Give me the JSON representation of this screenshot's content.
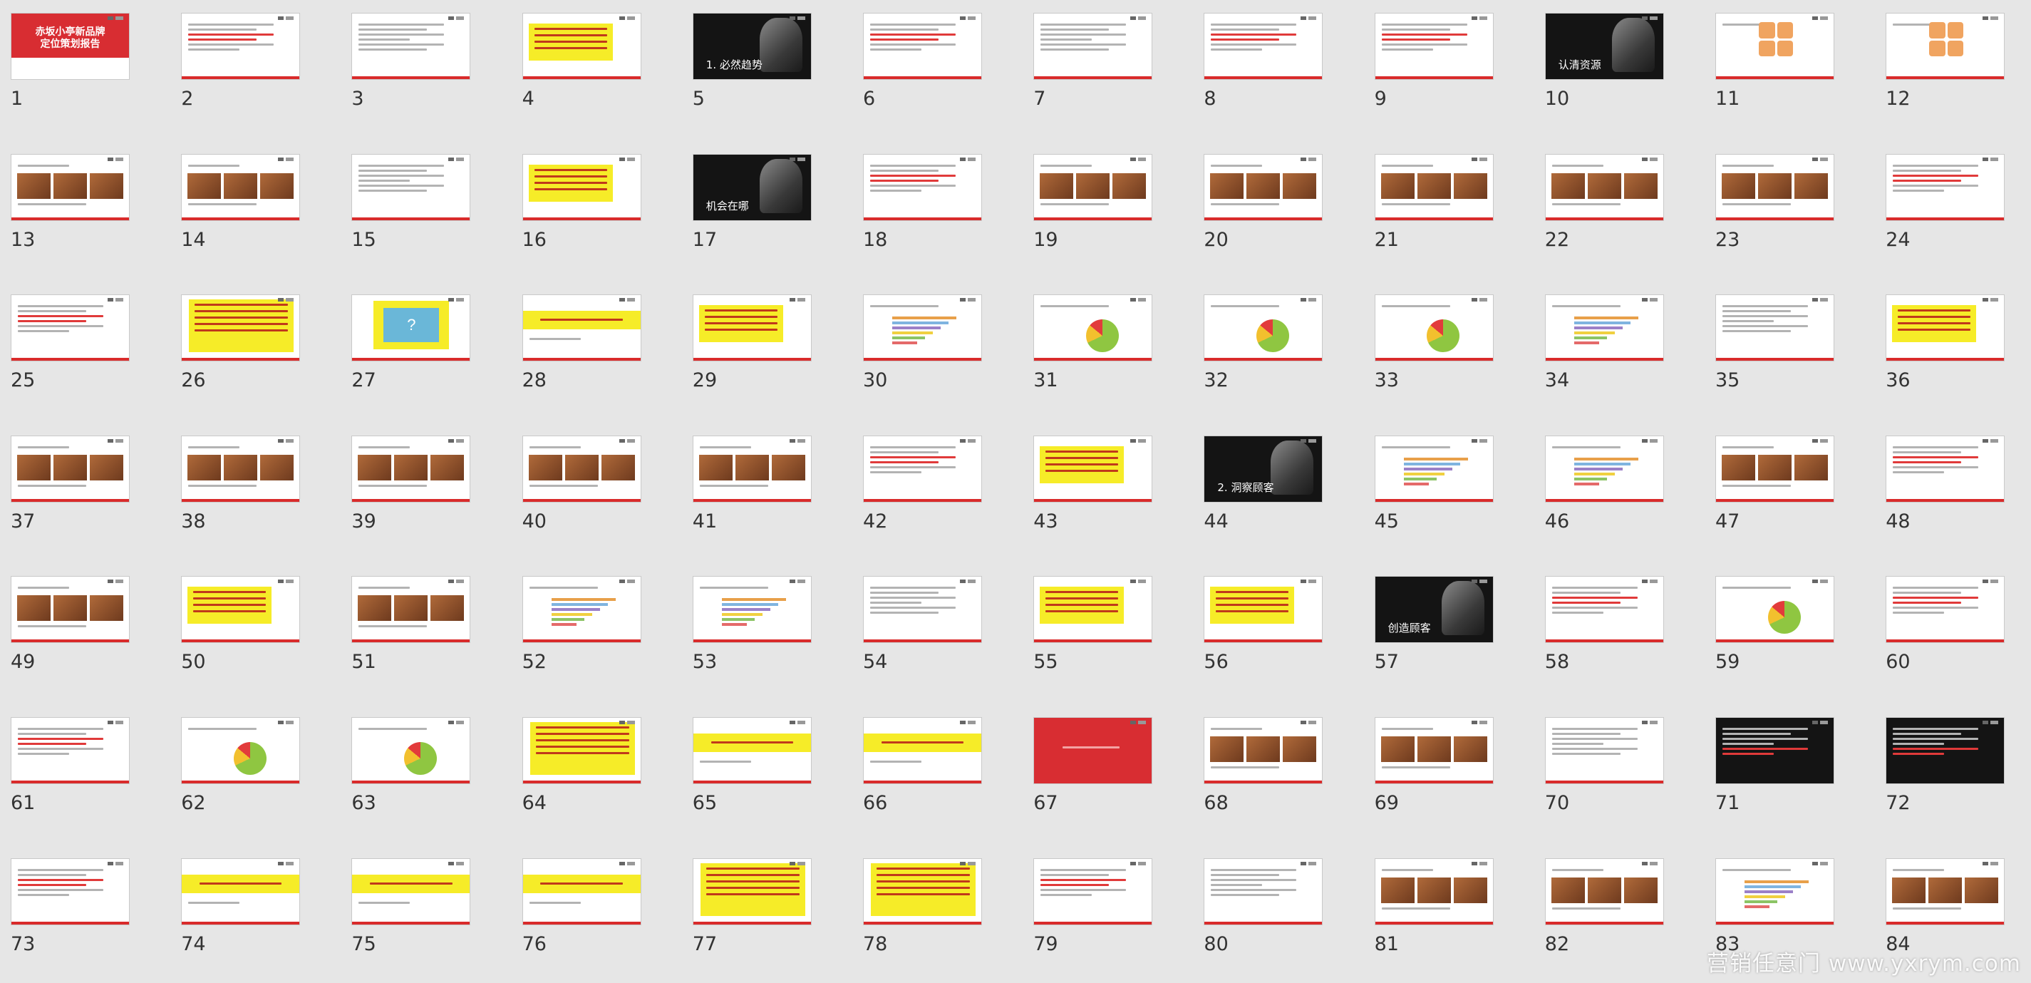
{
  "window": {
    "view": "slide-sorter"
  },
  "slides": [
    {
      "number": "1",
      "style": "red-title",
      "title": "赤坂小亭新品牌\n定位策划报告"
    },
    {
      "number": "2",
      "style": "text-red"
    },
    {
      "number": "3",
      "style": "text"
    },
    {
      "number": "4",
      "style": "yellow-box"
    },
    {
      "number": "5",
      "style": "dark-photo",
      "caption": "1. 必然趋势"
    },
    {
      "number": "6",
      "style": "text-red"
    },
    {
      "number": "7",
      "style": "text"
    },
    {
      "number": "8",
      "style": "text-red"
    },
    {
      "number": "9",
      "style": "text-red"
    },
    {
      "number": "10",
      "style": "dark-photo",
      "caption": "认清资源"
    },
    {
      "number": "11",
      "style": "quad"
    },
    {
      "number": "12",
      "style": "quad"
    },
    {
      "number": "13",
      "style": "images"
    },
    {
      "number": "14",
      "style": "images"
    },
    {
      "number": "15",
      "style": "text"
    },
    {
      "number": "16",
      "style": "yellow-box"
    },
    {
      "number": "17",
      "style": "dark-photo",
      "caption": "机会在哪"
    },
    {
      "number": "18",
      "style": "text-red"
    },
    {
      "number": "19",
      "style": "images"
    },
    {
      "number": "20",
      "style": "images"
    },
    {
      "number": "21",
      "style": "images"
    },
    {
      "number": "22",
      "style": "images"
    },
    {
      "number": "23",
      "style": "images"
    },
    {
      "number": "24",
      "style": "text-red"
    },
    {
      "number": "25",
      "style": "text-red"
    },
    {
      "number": "26",
      "style": "yellow-full"
    },
    {
      "number": "27",
      "style": "question",
      "caption": "?"
    },
    {
      "number": "28",
      "style": "yellow-title"
    },
    {
      "number": "29",
      "style": "yellow-box"
    },
    {
      "number": "30",
      "style": "bars"
    },
    {
      "number": "31",
      "style": "pie"
    },
    {
      "number": "32",
      "style": "pie"
    },
    {
      "number": "33",
      "style": "pie"
    },
    {
      "number": "34",
      "style": "bars"
    },
    {
      "number": "35",
      "style": "text"
    },
    {
      "number": "36",
      "style": "yellow-box"
    },
    {
      "number": "37",
      "style": "images"
    },
    {
      "number": "38",
      "style": "images"
    },
    {
      "number": "39",
      "style": "images"
    },
    {
      "number": "40",
      "style": "images"
    },
    {
      "number": "41",
      "style": "images"
    },
    {
      "number": "42",
      "style": "text-red"
    },
    {
      "number": "43",
      "style": "yellow-box"
    },
    {
      "number": "44",
      "style": "dark-photo",
      "caption": "2. 洞察顾客"
    },
    {
      "number": "45",
      "style": "bars"
    },
    {
      "number": "46",
      "style": "bars"
    },
    {
      "number": "47",
      "style": "images"
    },
    {
      "number": "48",
      "style": "text-red"
    },
    {
      "number": "49",
      "style": "images"
    },
    {
      "number": "50",
      "style": "yellow-box"
    },
    {
      "number": "51",
      "style": "images"
    },
    {
      "number": "52",
      "style": "bars"
    },
    {
      "number": "53",
      "style": "bars"
    },
    {
      "number": "54",
      "style": "text"
    },
    {
      "number": "55",
      "style": "yellow-box"
    },
    {
      "number": "56",
      "style": "yellow-box"
    },
    {
      "number": "57",
      "style": "dark-photo",
      "caption": "创造顾客"
    },
    {
      "number": "58",
      "style": "text-red"
    },
    {
      "number": "59",
      "style": "pie"
    },
    {
      "number": "60",
      "style": "text-red"
    },
    {
      "number": "61",
      "style": "text-red"
    },
    {
      "number": "62",
      "style": "pie"
    },
    {
      "number": "63",
      "style": "pie"
    },
    {
      "number": "64",
      "style": "yellow-full"
    },
    {
      "number": "65",
      "style": "yellow-title"
    },
    {
      "number": "66",
      "style": "yellow-title"
    },
    {
      "number": "67",
      "style": "red-plain"
    },
    {
      "number": "68",
      "style": "images"
    },
    {
      "number": "69",
      "style": "images"
    },
    {
      "number": "70",
      "style": "text"
    },
    {
      "number": "71",
      "style": "dark-text"
    },
    {
      "number": "72",
      "style": "dark-text"
    },
    {
      "number": "73",
      "style": "text-red"
    },
    {
      "number": "74",
      "style": "yellow-title"
    },
    {
      "number": "75",
      "style": "yellow-title"
    },
    {
      "number": "76",
      "style": "yellow-title"
    },
    {
      "number": "77",
      "style": "yellow-full"
    },
    {
      "number": "78",
      "style": "yellow-full"
    },
    {
      "number": "79",
      "style": "text-red"
    },
    {
      "number": "80",
      "style": "text"
    },
    {
      "number": "81",
      "style": "images"
    },
    {
      "number": "82",
      "style": "images"
    },
    {
      "number": "83",
      "style": "bars"
    },
    {
      "number": "84",
      "style": "images"
    }
  ],
  "watermark": "营销任意门 www.yxrym.com",
  "colors": {
    "accent_red": "#d92b2b",
    "highlight_yellow": "#f6ec28",
    "background": "#e6e6e6"
  }
}
